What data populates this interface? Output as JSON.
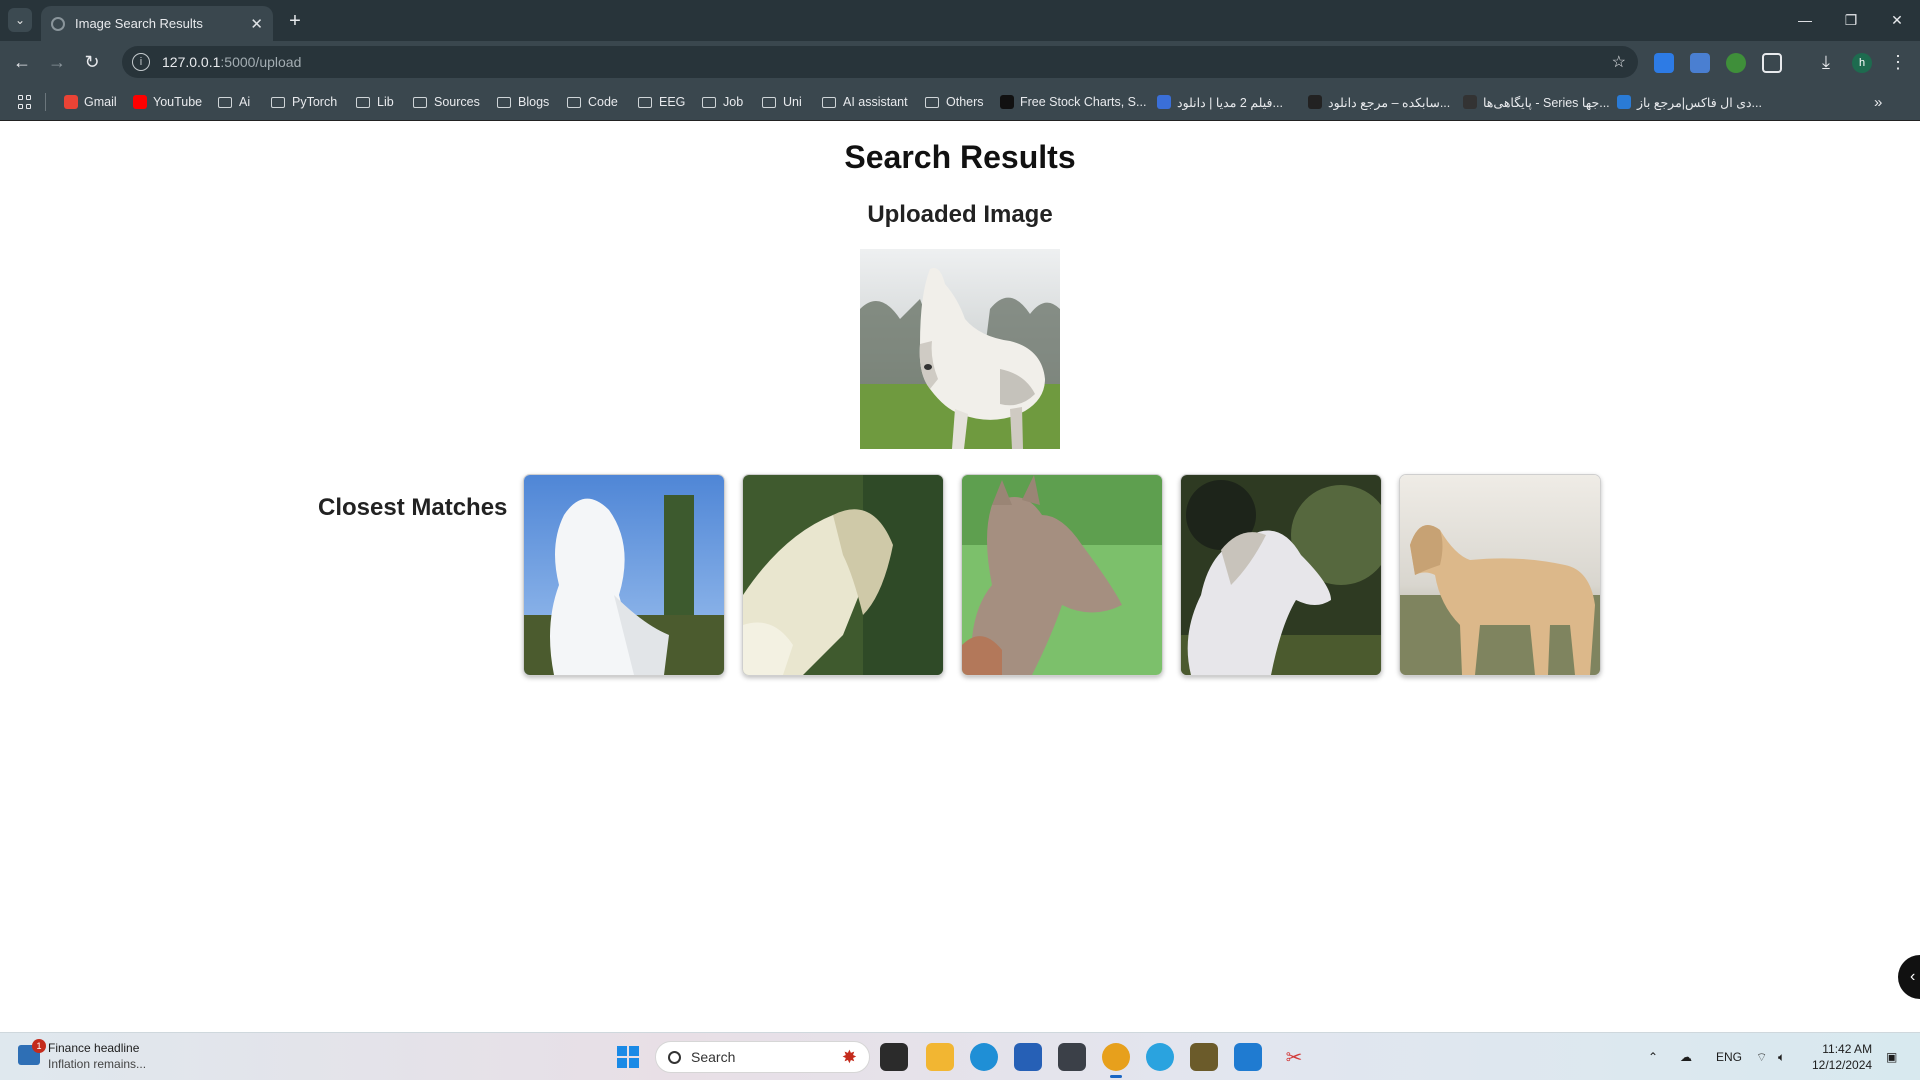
{
  "browser": {
    "tab": {
      "title": "Image Search Results"
    },
    "url": {
      "host": "127.0.0.1",
      "path": ":5000/upload"
    },
    "bookmarks": [
      {
        "label": "Gmail",
        "kind": "site",
        "color": "#ea4335"
      },
      {
        "label": "YouTube",
        "kind": "site",
        "color": "#ff0000"
      },
      {
        "label": "Ai",
        "kind": "folder"
      },
      {
        "label": "PyTorch",
        "kind": "folder"
      },
      {
        "label": "Lib",
        "kind": "folder"
      },
      {
        "label": "Sources",
        "kind": "folder"
      },
      {
        "label": "Blogs",
        "kind": "folder"
      },
      {
        "label": "Code",
        "kind": "folder"
      },
      {
        "label": "EEG",
        "kind": "folder"
      },
      {
        "label": "Job",
        "kind": "folder"
      },
      {
        "label": "Uni",
        "kind": "folder"
      },
      {
        "label": "AI assistant",
        "kind": "folder"
      },
      {
        "label": "Others",
        "kind": "folder"
      },
      {
        "label": "Free Stock Charts, S...",
        "kind": "site",
        "color": "#111111"
      },
      {
        "label": "فیلم 2 مدیا | دانلود...",
        "kind": "site",
        "color": "#3a6fd8"
      },
      {
        "label": "سابکده – مرجع دانلود...",
        "kind": "site",
        "color": "#222222"
      },
      {
        "label": "پایگاهی‌ها - Series جها...",
        "kind": "site",
        "color": "#333333"
      },
      {
        "label": "دی ال فاکس|مرجع باز...",
        "kind": "site",
        "color": "#2a7bd6"
      }
    ]
  },
  "page": {
    "title": "Search Results",
    "uploaded_heading": "Uploaded Image",
    "matches_heading": "Closest Matches",
    "uploaded_image": "white horse standing on grass",
    "matches": [
      "white horse against blue sky",
      "cream horse in blurred greenery",
      "brown foal on green grass",
      "white horse head against dark trees",
      "palomino horse standing in field"
    ]
  },
  "taskbar": {
    "news_title": "Finance headline",
    "news_sub": "Inflation remains...",
    "news_badge": "1",
    "search_placeholder": "Search",
    "language": "ENG",
    "time": "11:42 AM",
    "date": "12/12/2024",
    "accent": "#1a66c4"
  }
}
